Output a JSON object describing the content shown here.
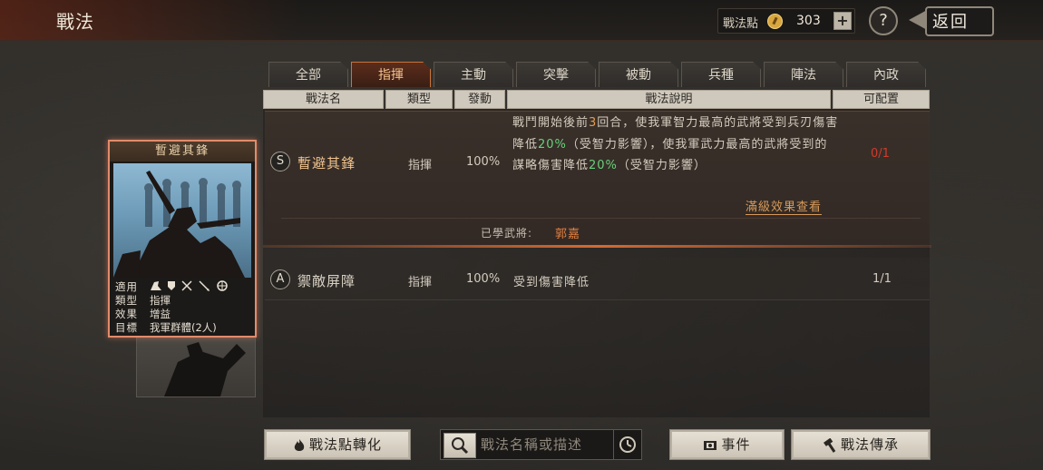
{
  "header": {
    "title": "戰法",
    "points_label": "戰法點",
    "points_value": "303",
    "plus_label": "+",
    "help_label": "?",
    "back_label": "返回"
  },
  "tabs": [
    {
      "label": "全部",
      "active": false
    },
    {
      "label": "指揮",
      "active": true
    },
    {
      "label": "主動",
      "active": false
    },
    {
      "label": "突擊",
      "active": false
    },
    {
      "label": "被動",
      "active": false
    },
    {
      "label": "兵種",
      "active": false
    },
    {
      "label": "陣法",
      "active": false
    },
    {
      "label": "內政",
      "active": false
    }
  ],
  "columns": [
    "戰法名",
    "類型",
    "發動",
    "戰法說明",
    "可配置"
  ],
  "rows": [
    {
      "grade": "S",
      "name": "暫避其鋒",
      "type": "指揮",
      "rate": "100%",
      "desc_parts": [
        {
          "t": "戰鬥開始後前",
          "c": ""
        },
        {
          "t": "3",
          "c": "o"
        },
        {
          "t": "回合，使我軍智力最高的武將受到兵刃傷害降低",
          "c": ""
        },
        {
          "t": "20%",
          "c": "g"
        },
        {
          "t": "（受智力影響），使我軍武力最高的武將受到的謀略傷害降低",
          "c": ""
        },
        {
          "t": "20%",
          "c": "g"
        },
        {
          "t": "（受智力影響）",
          "c": ""
        }
      ],
      "slots": "0/1",
      "slots_color": "#d23a2a",
      "max_effect_link": "滿級效果查看",
      "learned_label": "已學武將:",
      "learned_value": "郭嘉"
    },
    {
      "grade": "A",
      "name": "禦敵屏障",
      "type": "指揮",
      "rate": "100%",
      "desc": "受到傷害降低",
      "slots": "1/1"
    }
  ],
  "card": {
    "title": "暫避其鋒",
    "info": [
      {
        "k": "適用",
        "v": ""
      },
      {
        "k": "類型",
        "v": "指揮"
      },
      {
        "k": "效果",
        "v": "增益"
      },
      {
        "k": "目標",
        "v": "我軍群體(2人)"
      }
    ],
    "unit_icons": [
      "cavalry-icon",
      "shield-icon",
      "bow-icon",
      "spear-icon",
      "wheel-icon"
    ]
  },
  "bottom": {
    "convert_label": "戰法點轉化",
    "search_placeholder": "戰法名稱或描述",
    "event_label": "事件",
    "inherit_label": "戰法傳承"
  },
  "colors": {
    "accent": "#c8743a",
    "green_value": "#67d27a",
    "learned_name": "#e27f3f"
  }
}
